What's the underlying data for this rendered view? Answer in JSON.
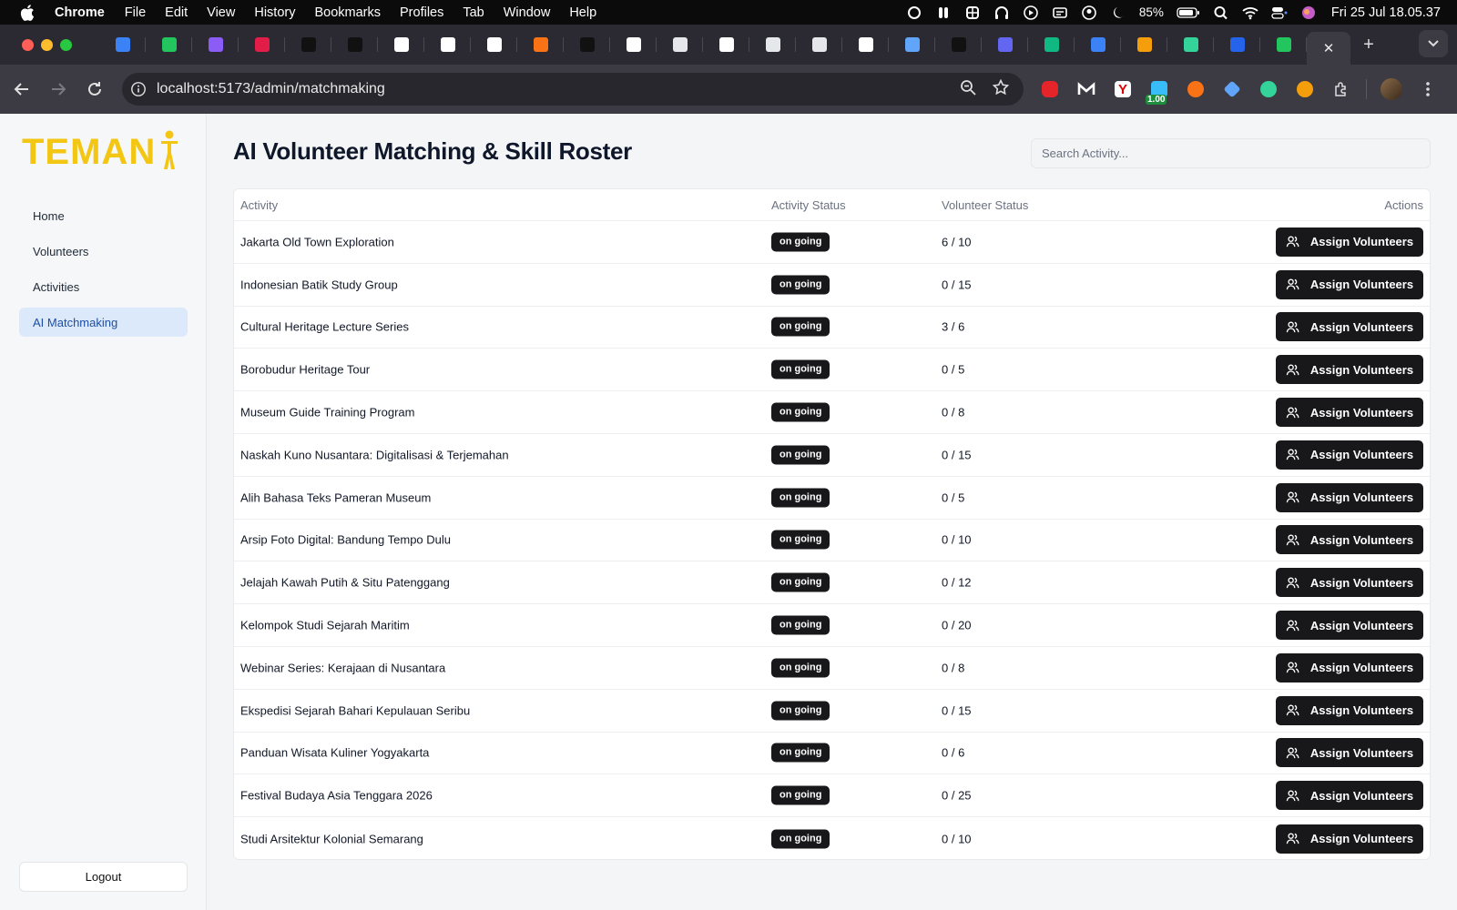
{
  "menubar": {
    "app_name": "Chrome",
    "items": [
      "File",
      "Edit",
      "View",
      "History",
      "Bookmarks",
      "Profiles",
      "Tab",
      "Window",
      "Help"
    ],
    "battery_percent": "85%",
    "clock": "Fri 25 Jul  18.05.37"
  },
  "browser": {
    "url": "localhost:5173/admin/matchmaking",
    "active_tab_close": "✕",
    "new_tab": "+",
    "extension_badge": "1.00",
    "tab_favicon_colors": [
      "#3b82f6",
      "#22c55e",
      "#8b5cf6",
      "#e11d48",
      "#111111",
      "#111111",
      "#ffffff",
      "#ffffff",
      "#ffffff",
      "#f97316",
      "#111111",
      "#ffffff",
      "#e5e7eb",
      "#ffffff",
      "#e5e7eb",
      "#e5e7eb",
      "#ffffff",
      "#60a5fa",
      "#111111",
      "#6366f1",
      "#10b981",
      "#3b82f6",
      "#f59e0b",
      "#34d399",
      "#2563eb",
      "#22c55e"
    ]
  },
  "sidebar": {
    "logo": "TEMAN",
    "items": [
      {
        "label": "Home"
      },
      {
        "label": "Volunteers"
      },
      {
        "label": "Activities"
      },
      {
        "label": "AI Matchmaking",
        "active": true
      }
    ],
    "logout_label": "Logout"
  },
  "main": {
    "title": "AI Volunteer Matching & Skill Roster",
    "search_placeholder": "Search Activity...",
    "columns": {
      "activity": "Activity",
      "activity_status": "Activity Status",
      "volunteer_status": "Volunteer Status",
      "actions": "Actions"
    },
    "assign_label": "Assign Volunteers",
    "rows": [
      {
        "activity": "Jakarta Old Town Exploration",
        "status": "on going",
        "volunteers": "6 / 10"
      },
      {
        "activity": "Indonesian Batik Study Group",
        "status": "on going",
        "volunteers": "0 / 15"
      },
      {
        "activity": "Cultural Heritage Lecture Series",
        "status": "on going",
        "volunteers": "3 / 6"
      },
      {
        "activity": "Borobudur Heritage Tour",
        "status": "on going",
        "volunteers": "0 / 5"
      },
      {
        "activity": "Museum Guide Training Program",
        "status": "on going",
        "volunteers": "0 / 8"
      },
      {
        "activity": "Naskah Kuno Nusantara: Digitalisasi & Terjemahan",
        "status": "on going",
        "volunteers": "0 / 15"
      },
      {
        "activity": "Alih Bahasa Teks Pameran Museum",
        "status": "on going",
        "volunteers": "0 / 5"
      },
      {
        "activity": "Arsip Foto Digital: Bandung Tempo Dulu",
        "status": "on going",
        "volunteers": "0 / 10"
      },
      {
        "activity": "Jelajah Kawah Putih & Situ Patenggang",
        "status": "on going",
        "volunteers": "0 / 12"
      },
      {
        "activity": "Kelompok Studi Sejarah Maritim",
        "status": "on going",
        "volunteers": "0 / 20"
      },
      {
        "activity": "Webinar Series: Kerajaan di Nusantara",
        "status": "on going",
        "volunteers": "0 / 8"
      },
      {
        "activity": "Ekspedisi Sejarah Bahari Kepulauan Seribu",
        "status": "on going",
        "volunteers": "0 / 15"
      },
      {
        "activity": "Panduan Wisata Kuliner Yogyakarta",
        "status": "on going",
        "volunteers": "0 / 6"
      },
      {
        "activity": "Festival Budaya Asia Tenggara 2026",
        "status": "on going",
        "volunteers": "0 / 25"
      },
      {
        "activity": "Studi Arsitektur Kolonial Semarang",
        "status": "on going",
        "volunteers": "0 / 10"
      }
    ]
  },
  "colors": {
    "logo_yellow": "#f3c614",
    "active_nav_bg": "#dbe9fb",
    "active_nav_text": "#1e4fa3",
    "button_dark": "#18181b"
  }
}
